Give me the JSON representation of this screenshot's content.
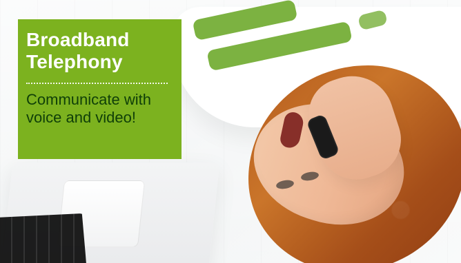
{
  "promo": {
    "title_line_1": "Broadband",
    "title_line_2": "Telephony",
    "subtitle": "Communicate with voice and video!",
    "brand_green": "#7cb21f",
    "subtitle_color": "#0f3f08"
  },
  "image": {
    "depiction": "woman lying on floor talking on phone next to laptop"
  }
}
